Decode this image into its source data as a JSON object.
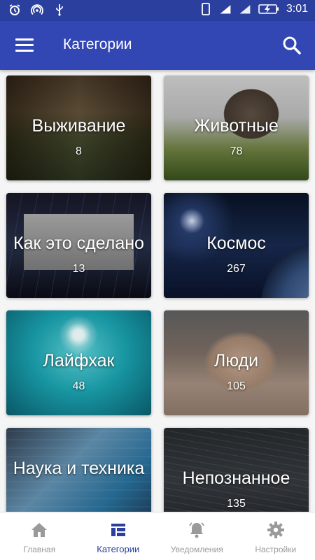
{
  "statusbar": {
    "time": "3:01",
    "icons": [
      "alarm-icon",
      "hotspot-icon",
      "usb-icon",
      "phone-icon",
      "signal-icon",
      "signal-icon",
      "battery-icon"
    ]
  },
  "appbar": {
    "title": "Категории",
    "menu_icon": "menu-icon",
    "search_icon": "search-icon"
  },
  "categories": [
    {
      "name": "Выживание",
      "count": "8"
    },
    {
      "name": "Животные",
      "count": "78"
    },
    {
      "name": "Как это сделано",
      "count": "13"
    },
    {
      "name": "Космос",
      "count": "267"
    },
    {
      "name": "Лайфхак",
      "count": "48"
    },
    {
      "name": "Люди",
      "count": "105"
    },
    {
      "name": "Наука и техника",
      "count": ""
    },
    {
      "name": "Непознанное",
      "count": "135"
    }
  ],
  "bottomnav": [
    {
      "label": "Главная",
      "icon": "home-icon"
    },
    {
      "label": "Категории",
      "icon": "categories-icon",
      "active": true
    },
    {
      "label": "Уведомления",
      "icon": "bell-icon"
    },
    {
      "label": "Настройки",
      "icon": "gear-icon"
    }
  ],
  "colors": {
    "primary": "#3247b3",
    "statusbar": "#2a3f9e",
    "active_nav": "#2a3f9e",
    "inactive_nav": "#9a9a9a"
  }
}
